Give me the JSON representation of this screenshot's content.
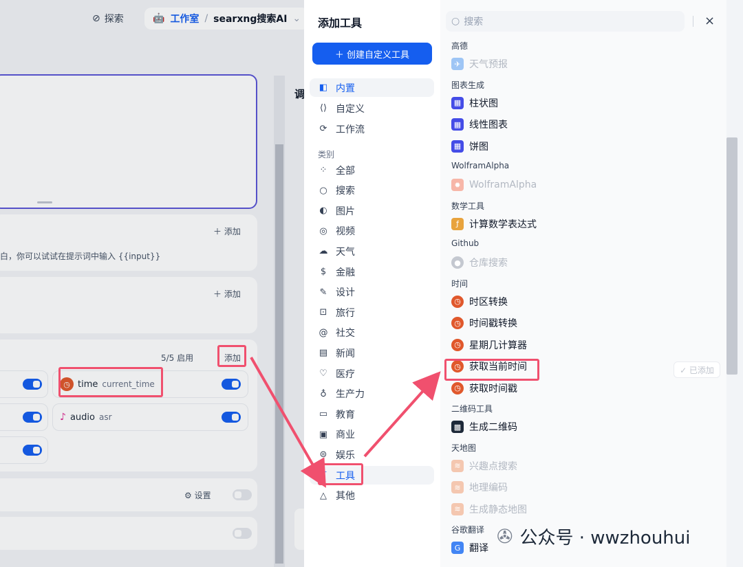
{
  "topbar": {
    "explore_label": "探索",
    "workspace_label": "工作室",
    "separator": "/",
    "app_name": "searxng搜索AI"
  },
  "left_bg": {
    "card1": {
      "add_label": "＋ 添加",
      "hint": "白，你可以试试在提示词中输入 {{input}}"
    },
    "card2": {
      "add_label": "＋ 添加"
    },
    "tools_card": {
      "status": "5/5 启用",
      "add_label": "添加"
    },
    "tools": [
      {
        "name": "time",
        "sub": "current_time"
      },
      {
        "name": "audio",
        "sub": "asr"
      }
    ],
    "settings_label": "设置",
    "side_label": "调"
  },
  "panel": {
    "title": "添加工具",
    "create_button": "＋ 创建自定义工具",
    "nav": [
      {
        "label": "内置",
        "icon": "◧",
        "active": true
      },
      {
        "label": "自定义",
        "icon": "⟨⟩"
      },
      {
        "label": "工作流",
        "icon": "⟳"
      }
    ],
    "category_label": "类别",
    "categories": [
      {
        "label": "全部",
        "icon": "⁘"
      },
      {
        "label": "搜索",
        "icon": "○"
      },
      {
        "label": "图片",
        "icon": "◐"
      },
      {
        "label": "视频",
        "icon": "◎"
      },
      {
        "label": "天气",
        "icon": "☁"
      },
      {
        "label": "金融",
        "icon": "$"
      },
      {
        "label": "设计",
        "icon": "✎"
      },
      {
        "label": "旅行",
        "icon": "⊡"
      },
      {
        "label": "社交",
        "icon": "@"
      },
      {
        "label": "新闻",
        "icon": "▤"
      },
      {
        "label": "医疗",
        "icon": "♡"
      },
      {
        "label": "生产力",
        "icon": "♁"
      },
      {
        "label": "教育",
        "icon": "▭"
      },
      {
        "label": "商业",
        "icon": "▣"
      },
      {
        "label": "娱乐",
        "icon": "⊜"
      },
      {
        "label": "工具",
        "icon": "⊤",
        "active": true
      },
      {
        "label": "其他",
        "icon": "△"
      }
    ],
    "search_placeholder": "搜索",
    "close": "×",
    "groups": [
      {
        "name": "高德",
        "items": [
          {
            "label": "天气预报",
            "dim": true,
            "icon": "✈",
            "color": "#9ec5f5"
          }
        ]
      },
      {
        "name": "图表生成",
        "items": [
          {
            "label": "柱状图",
            "icon": "▦",
            "color": "#444ce7"
          },
          {
            "label": "线性图表",
            "icon": "▦",
            "color": "#444ce7"
          },
          {
            "label": "饼图",
            "icon": "▦",
            "color": "#444ce7"
          }
        ]
      },
      {
        "name": "WolframAlpha",
        "items": [
          {
            "label": "WolframAlpha",
            "dim": true,
            "icon": "✹",
            "color": "#f7b6a8"
          }
        ]
      },
      {
        "name": "数学工具",
        "items": [
          {
            "label": "计算数学表达式",
            "icon": "ƒ",
            "color": "#e8a33d"
          }
        ]
      },
      {
        "name": "Github",
        "items": [
          {
            "label": "仓库搜索",
            "dim": true,
            "icon": "●",
            "color": "#c4c8d0"
          }
        ]
      },
      {
        "name": "时间",
        "items": [
          {
            "label": "时区转换",
            "icon": "◷",
            "color": "#e0582c"
          },
          {
            "label": "时间戳转换",
            "icon": "◷",
            "color": "#e0582c"
          },
          {
            "label": "星期几计算器",
            "icon": "◷",
            "color": "#e0582c"
          },
          {
            "label": "获取当前时间",
            "icon": "◷",
            "color": "#e0582c",
            "added": true
          },
          {
            "label": "获取时间戳",
            "icon": "◷",
            "color": "#e0582c"
          }
        ]
      },
      {
        "name": "二维码工具",
        "items": [
          {
            "label": "生成二维码",
            "icon": "▩",
            "color": "#1d2939"
          }
        ]
      },
      {
        "name": "天地图",
        "items": [
          {
            "label": "兴趣点搜索",
            "dim": true,
            "icon": "≋",
            "color": "#f4c7b0"
          },
          {
            "label": "地理编码",
            "dim": true,
            "icon": "≋",
            "color": "#f4c7b0"
          },
          {
            "label": "生成静态地图",
            "dim": true,
            "icon": "≋",
            "color": "#f4c7b0"
          }
        ]
      },
      {
        "name": "谷歌翻译",
        "items": [
          {
            "label": "翻译",
            "icon": "G",
            "color": "#4285f4"
          }
        ]
      }
    ],
    "added_label": "✓ 已添加"
  },
  "watermark": {
    "text": "公众号 · wwzhouhui"
  },
  "colors": {
    "accent": "#155eef",
    "highlight": "#f0506e",
    "arrow": "#f0506e"
  }
}
